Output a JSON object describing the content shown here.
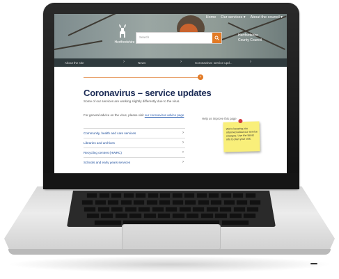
{
  "site": {
    "logo_text": "Hertfordshire",
    "council_line1": "Hertfordshire",
    "council_line2": "County Council"
  },
  "topnav": {
    "items": [
      "Home",
      "Our services ▾",
      "About the council ▾"
    ]
  },
  "search": {
    "placeholder": "Search"
  },
  "menubar": {
    "items": [
      "About the site",
      "News",
      "Coronavirus: service upd..."
    ]
  },
  "page": {
    "title": "Coronavirus – service updates",
    "intro": "Some of our services are working slightly differently due to the virus.",
    "intro2_text": "For general advice on the virus, please visit",
    "intro2_link": "our coronavirus advice page",
    "services": [
      "Community, health and care services",
      "Libraries and archives",
      "Recycling centres (HWRC)",
      "Schools and early years services"
    ],
    "side_link": "Help us improve this page"
  },
  "sticky_note": {
    "text": "We're keeping you informed about our service changes. Use the latest info to plan your visit."
  },
  "colors": {
    "accent": "#e27a25",
    "title": "#1a2a55",
    "menubar": "#2f3a3d",
    "sticky": "#f9ef7a"
  }
}
